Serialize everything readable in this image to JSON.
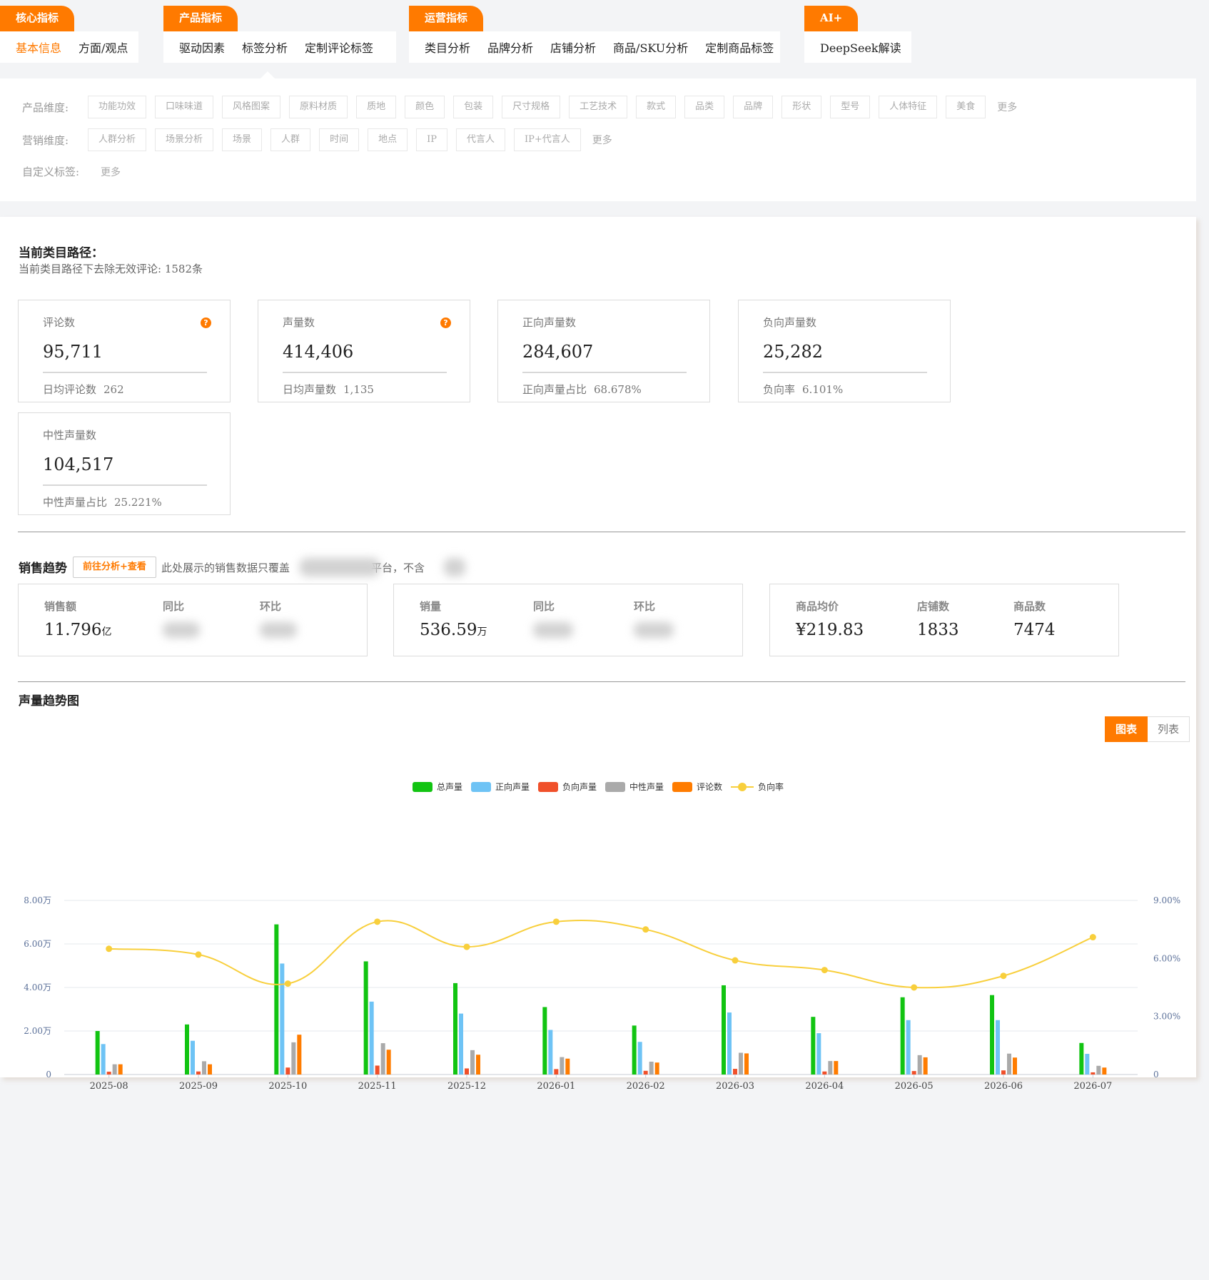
{
  "tab_groups": [
    {
      "title": "核心指标",
      "items": [
        "基本信息",
        "方面/观点"
      ],
      "active_item": 0
    },
    {
      "title": "产品指标",
      "items": [
        "驱动因素",
        "标签分析",
        "定制评论标签"
      ],
      "active_item": -1
    },
    {
      "title": "运营指标",
      "items": [
        "类目分析",
        "品牌分析",
        "店铺分析",
        "商品/SKU分析",
        "定制商品标签"
      ],
      "active_item": -1
    },
    {
      "title": "AI+",
      "items": [
        "DeepSeek解读"
      ],
      "active_item": -1
    }
  ],
  "dimensions": {
    "product": {
      "label": "产品维度:",
      "chips": [
        "功能功效",
        "口味味道",
        "风格图案",
        "原料材质",
        "质地",
        "颜色",
        "包装",
        "尺寸规格",
        "工艺技术",
        "款式",
        "品类",
        "品牌",
        "形状",
        "型号",
        "人体特征",
        "美食"
      ],
      "more": "更多"
    },
    "marketing": {
      "label": "营销维度:",
      "chips": [
        "人群分析",
        "场景分析",
        "场景",
        "人群",
        "时间",
        "地点",
        "IP",
        "代言人",
        "IP+代言人"
      ],
      "more": "更多"
    },
    "custom": {
      "label": "自定义标签:",
      "more": "更多"
    }
  },
  "category_path": {
    "title": "当前类目路径：",
    "subtitle": "当前类目路径下去除无效评论: 1582条"
  },
  "metrics": [
    {
      "label": "评论数",
      "value": "95,711",
      "foot_label": "日均评论数",
      "foot_value": "262",
      "help": true
    },
    {
      "label": "声量数",
      "value": "414,406",
      "foot_label": "日均声量数",
      "foot_value": "1,135",
      "help": true
    },
    {
      "label": "正向声量数",
      "value": "284,607",
      "foot_label": "正向声量占比",
      "foot_value": "68.678%",
      "help": false
    },
    {
      "label": "负向声量数",
      "value": "25,282",
      "foot_label": "负向率",
      "foot_value": "6.101%",
      "help": false
    },
    {
      "label": "中性声量数",
      "value": "104,517",
      "foot_label": "中性声量占比",
      "foot_value": "25.221%",
      "help": false
    }
  ],
  "sales": {
    "title": "销售趋势",
    "button": "前往分析+查看",
    "note_prefix": "此处展示的销售数据只覆盖",
    "note_mid": "平台，不含",
    "box1": {
      "l1": "销售额",
      "v1": "11.796",
      "u1": "亿",
      "l2": "同比",
      "l3": "环比"
    },
    "box2": {
      "l1": "销量",
      "v1": "536.59",
      "u1": "万",
      "l2": "同比",
      "l3": "环比"
    },
    "box3": {
      "l1": "商品均价",
      "v1": "¥219.83",
      "l2": "店铺数",
      "v2": "1833",
      "l3": "商品数",
      "v3": "7474"
    }
  },
  "trend": {
    "title": "声量趋势图",
    "view_chart": "图表",
    "view_list": "列表"
  },
  "chart_data": {
    "type": "bar",
    "categories": [
      "2025-08",
      "2025-09",
      "2025-10",
      "2025-11",
      "2025-12",
      "2026-01",
      "2026-02",
      "2026-03",
      "2026-04",
      "2026-05",
      "2026-06",
      "2026-07"
    ],
    "series": [
      {
        "name": "总声量",
        "color": "#12c412",
        "values": [
          20000,
          23000,
          69000,
          52000,
          42000,
          31000,
          22500,
          41000,
          26500,
          35500,
          36500,
          14500
        ]
      },
      {
        "name": "正向声量",
        "color": "#6ec3f5",
        "values": [
          14000,
          15500,
          51000,
          33500,
          28000,
          20500,
          15000,
          28500,
          19000,
          25000,
          25000,
          9500
        ]
      },
      {
        "name": "负向声量",
        "color": "#f0502a",
        "values": [
          1300,
          1400,
          3200,
          4100,
          2800,
          2500,
          1700,
          2600,
          1400,
          1600,
          1900,
          1000
        ]
      },
      {
        "name": "中性声量",
        "color": "#aaaaaa",
        "values": [
          4700,
          6100,
          14800,
          14400,
          11200,
          8000,
          5900,
          10000,
          6200,
          8900,
          9600,
          4000
        ]
      },
      {
        "name": "评论数",
        "color": "#ff7c00",
        "values": [
          4700,
          4700,
          18300,
          11400,
          9100,
          7300,
          5500,
          9700,
          6200,
          7900,
          7800,
          3200
        ]
      },
      {
        "name": "负向率",
        "color": "#f8cf3c",
        "axis": "right",
        "values": [
          6.5,
          6.2,
          4.7,
          7.9,
          6.6,
          7.9,
          7.5,
          5.9,
          5.4,
          4.5,
          5.1,
          7.1
        ]
      }
    ],
    "y_left": {
      "ticks": [
        "0",
        "2.00万",
        "4.00万",
        "6.00万",
        "8.00万"
      ],
      "range": [
        0,
        80000
      ]
    },
    "y_right": {
      "ticks": [
        "0",
        "3.00%",
        "6.00%",
        "9.00%"
      ],
      "range": [
        0,
        9
      ]
    },
    "grid": true,
    "legend_position": "top-center"
  }
}
